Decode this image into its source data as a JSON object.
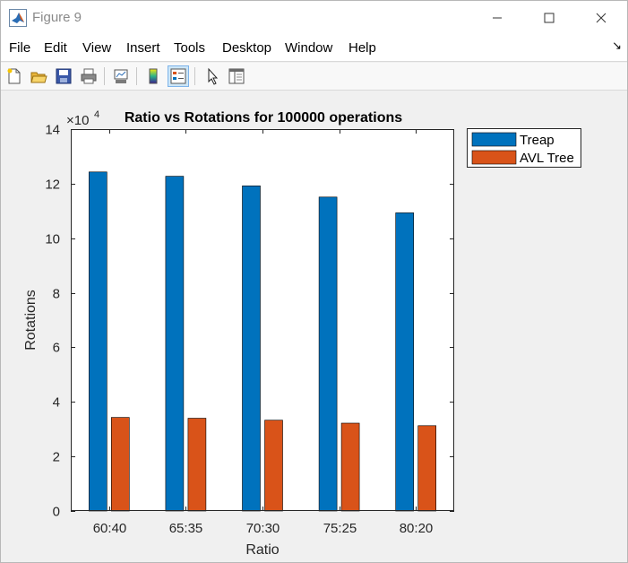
{
  "window": {
    "title": "Figure 9",
    "icon": "matlab-icon",
    "controls": [
      "minimize-icon",
      "maximize-icon",
      "close-icon"
    ]
  },
  "menu": {
    "items": [
      "File",
      "Edit",
      "View",
      "Insert",
      "Tools",
      "Desktop",
      "Window",
      "Help"
    ],
    "dock_arrow": "↘"
  },
  "toolbar": {
    "buttons": [
      "new-figure-icon",
      "open-file-icon",
      "save-icon",
      "print-icon",
      "link-plot-icon",
      "colorbar-icon",
      "legend-icon",
      "edit-plot-icon",
      "property-inspector-icon"
    ]
  },
  "chart_data": {
    "type": "bar",
    "title": "Ratio vs Rotations for 100000 operations",
    "xlabel": "Ratio",
    "ylabel": "Rotations",
    "y_exponent_base": "×10",
    "y_exponent_power": "4",
    "categories": [
      "60:40",
      "65:35",
      "70:30",
      "75:25",
      "80:20"
    ],
    "ylim": [
      0,
      140000
    ],
    "yticks": [
      0,
      20000,
      40000,
      60000,
      80000,
      100000,
      120000,
      140000
    ],
    "ytick_labels": [
      "0",
      "2",
      "4",
      "6",
      "8",
      "10",
      "12",
      "14"
    ],
    "grid": false,
    "legend_position": "outside-top-right",
    "series": [
      {
        "name": "Treap",
        "color": "#0072bd",
        "values": [
          124300,
          122700,
          119200,
          115100,
          109300
        ]
      },
      {
        "name": "AVL Tree",
        "color": "#d95319",
        "values": [
          34300,
          34000,
          33300,
          32200,
          31300
        ]
      }
    ]
  }
}
